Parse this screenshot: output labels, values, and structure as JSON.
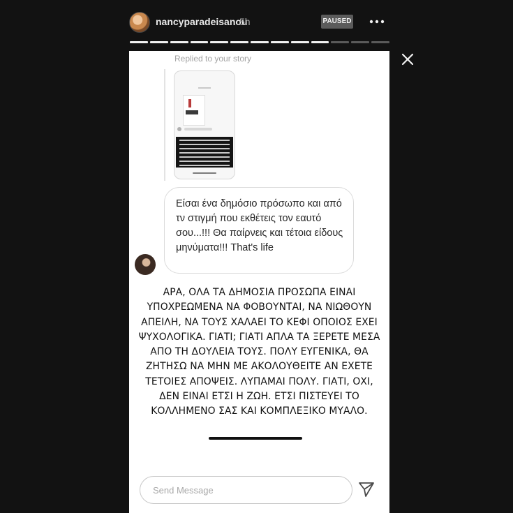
{
  "header": {
    "username": "nancyparadeisanou",
    "time_ago": "5h",
    "status_badge": "PAUSED",
    "more_icon": "more-horizontal-icon",
    "close_icon": "close-icon"
  },
  "progress": {
    "total_segments": 13,
    "completed_segments": 10
  },
  "story": {
    "replied_label": "Replied to your story",
    "message_text": "Είσαι ένα δημόσιο πρόσωπο και από τν στιγμή που εκθέτεις τον εαυτό σου...!!! Θα παίρνεις και τέτοια είδους μηνύματα!!! That's life",
    "caption_lines": [
      "ΑΡΑ, ΟΛΑ ΤΑ ΔΗΜΟΣΙΑ ΠΡΟΣΩΠΑ ΕΙΝΑΙ",
      "ΥΠΟΧΡΕΩΜΕΝΑ ΝΑ ΦΟΒΟΥΝΤΑΙ, ΝΑ ΝΙΩΘΟΥΝ",
      "ΑΠΕΙΛΗ, ΝΑ ΤΟΥΣ ΧΑΛΑΕΙ ΤΟ ΚΕΦΙ ΟΠΟΙΟΣ ΕΧΕΙ",
      "ΨΥΧΟΛΟΓΙΚΑ. ΓΙΑΤΙ; ΓΙΑΤΙ ΑΠΛΑ ΤΑ ΞΕΡΕΤΕ ΜΕΣΑ",
      "ΑΠΟ ΤΗ ΔΟΥΛΕΙΑ ΤΟΥΣ. ΠΟΛΥ ΕΥΓΕΝΙΚΑ, ΘΑ",
      "ΖΗΤΗΣΩ ΝΑ ΜΗΝ ΜΕ ΑΚΟΛΟΥΘΕΙΤΕ ΑΝ ΕΧΕΤΕ",
      "ΤΕΤΟΙΕΣ ΑΠΟΨΕΙΣ. ΛΥΠΑΜΑΙ ΠΟΛΥ. ΓΙΑΤΙ, ΟΧΙ,",
      "ΔΕΝ ΕΙΝΑΙ ΕΤΣΙ Η ΖΩΗ. ΕΤΣΙ ΠΙΣΤΕΥΕΙ ΤΟ",
      "ΚΟΛΛΗΜΕΝΟ ΣΑΣ ΚΑΙ ΚΟΜΠΛΕΞΙΚΟ ΜΥΑΛΟ."
    ]
  },
  "footer": {
    "message_placeholder": "Send Message",
    "send_icon": "send-icon"
  },
  "colors": {
    "background": "#121212",
    "story_background": "#ffffff",
    "badge": "#5b5b5b",
    "progress_done": "#f2f2f2",
    "progress_pending": "#5a5a5a"
  }
}
